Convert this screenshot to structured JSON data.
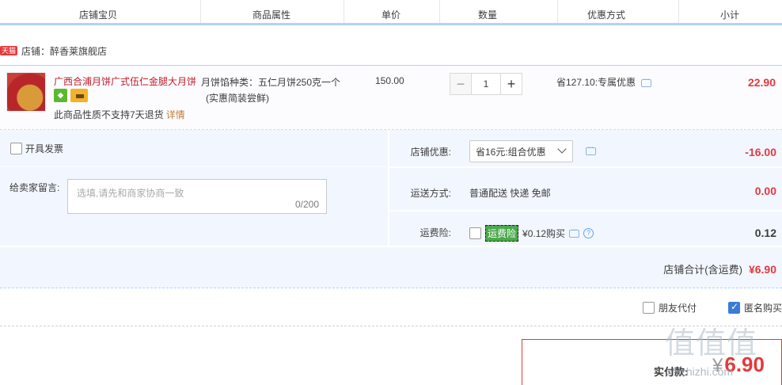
{
  "header": {
    "columns": [
      "店铺宝贝",
      "商品属性",
      "单价",
      "数量",
      "优惠方式",
      "小计"
    ]
  },
  "shop": {
    "badge": "天猫",
    "label": "店铺：醉香莱旗舰店"
  },
  "item": {
    "title": "广西合浦月饼广式伍仁金腿大月饼",
    "note": "此商品性质不支持7天退货",
    "note_link": "详情",
    "attr_line1": "月饼馅种类：五仁月饼250克一个",
    "attr_line2": "(实惠简装尝鲜)",
    "unit_price": "150.00",
    "quantity": "1",
    "qty_minus": "−",
    "qty_plus": "+",
    "discount": "省127.10:专属优惠",
    "subtotal": "22.90"
  },
  "options": {
    "invoice_label": "开具发票",
    "message_label": "给卖家留言:",
    "message_placeholder": "选填,请先和商家协商一致",
    "message_count": "0/200",
    "shop_discount_label": "店铺优惠:",
    "shop_discount_selected": "省16元:组合优惠",
    "shop_discount_value": "-16.00",
    "shipping_label": "运送方式:",
    "shipping_text": "普通配送 快递 免邮",
    "shipping_value": "0.00",
    "insurance_label": "运费险:",
    "insurance_badge": "运费险",
    "insurance_text": "¥0.12购买",
    "insurance_value": "0.12",
    "store_total_label": "店铺合计(含运费)",
    "store_total_value": "¥6.90"
  },
  "bottom": {
    "friend_pay": "朋友代付",
    "anonymous": "匿名购买",
    "pay_label": "实付款:",
    "pay_currency": "¥",
    "pay_amount": "6.90"
  },
  "watermark": {
    "logo": "值值值",
    "url": "zhizhizhi.com"
  },
  "colors": {
    "accent_red": "#e4393c",
    "header_line": "#b2d1ff",
    "option_bg": "#f2f7ff",
    "check_blue": "#3a7bd5"
  }
}
